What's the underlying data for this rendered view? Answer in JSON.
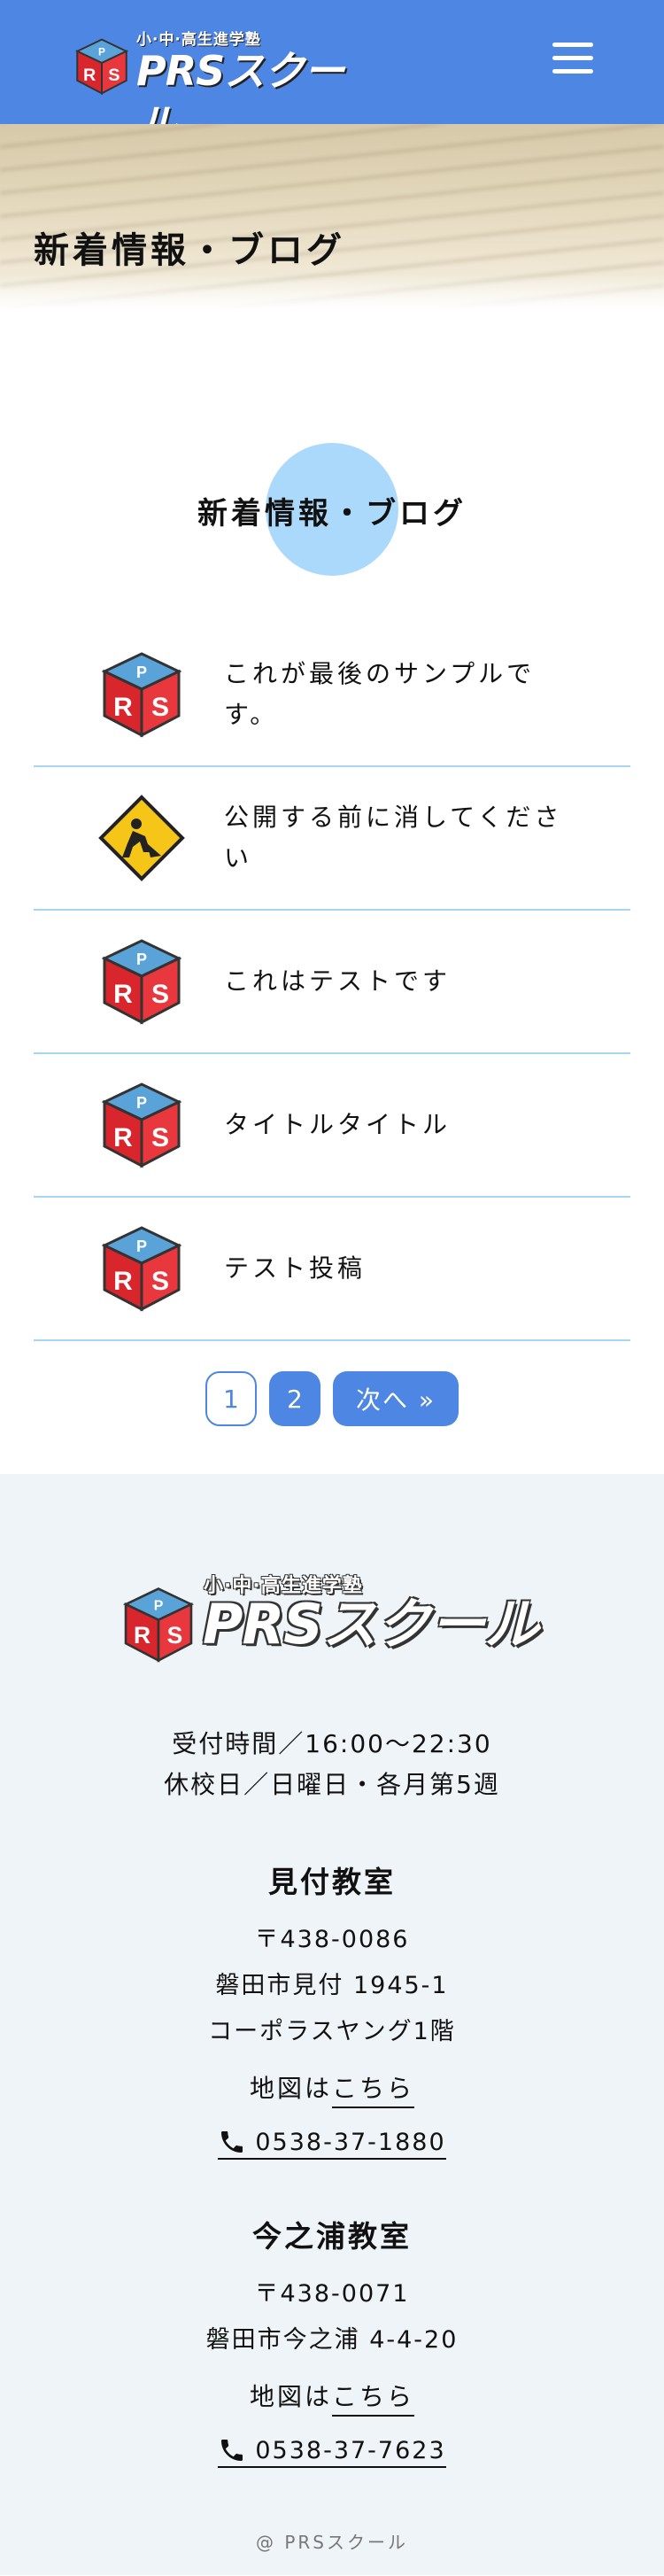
{
  "header": {
    "logo_sub": "小·中·高生進学塾",
    "logo_main": "PRSスクール",
    "logo_cube_text": "PRS"
  },
  "hero": {
    "title": "新着情報・ブログ"
  },
  "section": {
    "heading": "新着情報・ブログ"
  },
  "posts": [
    {
      "title": "これが最後のサンプルです。",
      "thumb": "prs-cube-icon"
    },
    {
      "title": "公開する前に消してください",
      "thumb": "construction-sign-icon"
    },
    {
      "title": "これはテストです",
      "thumb": "prs-cube-icon"
    },
    {
      "title": "タイトルタイトル",
      "thumb": "prs-cube-icon"
    },
    {
      "title": "テスト投稿",
      "thumb": "prs-cube-icon"
    }
  ],
  "pagination": {
    "current": "1",
    "page2": "2",
    "next": "次へ »"
  },
  "footer": {
    "logo_sub": "小·中·高生進学塾",
    "logo_main": "PRSスクール",
    "hours_line1": "受付時間／16:00〜22:30",
    "hours_line2": "休校日／日曜日・各月第5週",
    "campuses": [
      {
        "name": "見付教室",
        "postal": "〒438-0086",
        "address1": "磐田市見付 1945-1",
        "address2": "コーポラスヤング1階",
        "map_prefix": "地図は",
        "map_link": "こちら",
        "tel": "0538-37-1880"
      },
      {
        "name": "今之浦教室",
        "postal": "〒438-0071",
        "address1": "磐田市今之浦 4-4-20",
        "map_prefix": "地図は",
        "map_link": "こちら",
        "tel": "0538-37-7623"
      }
    ],
    "copyright": "@ PRSスクール"
  },
  "colors": {
    "header_bg": "#4e86e3",
    "accent_circle": "#abd9fb",
    "divider": "#a6d6f2",
    "footer_bg": "#eff4f9",
    "cube_red": "#d8262c",
    "cube_blue": "#5aa3d8"
  }
}
